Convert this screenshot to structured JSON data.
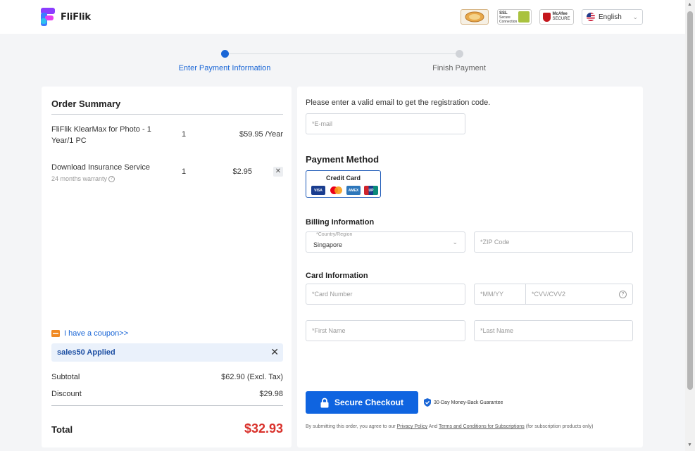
{
  "header": {
    "brand": "FliFlik",
    "badges": [
      "Norton",
      "SSL Secure Connection",
      "McAfee SECURE"
    ],
    "badge_mcafee_top": "McAfee",
    "badge_mcafee_bottom": "SECURE",
    "badge_ssl_line1": "SSL",
    "badge_ssl_line2": "Secure",
    "badge_ssl_line3": "Connection",
    "language": "English"
  },
  "steps": {
    "step1": "Enter Payment Information",
    "step2": "Finish Payment",
    "active_color": "#1a66d6",
    "inactive_color": "#d0d3d8"
  },
  "order": {
    "title": "Order Summary",
    "items": [
      {
        "name": "FliFlik KlearMax for Photo - 1 Year/1 PC",
        "qty": "1",
        "price": "$59.95 /Year"
      },
      {
        "name": "Download Insurance Service",
        "sub": "24 months warranty",
        "qty": "1",
        "price": "$2.95"
      }
    ],
    "coupon_link": "I have a coupon>>",
    "coupon_applied": "sales50 Applied",
    "subtotal_label": "Subtotal",
    "subtotal_value": "$62.90 (Excl. Tax)",
    "discount_label": "Discount",
    "discount_value": "$29.98",
    "total_label": "Total",
    "total_value": "$32.93"
  },
  "payment": {
    "email_prompt": "Please enter a valid email to get the registration code.",
    "email_placeholder": "*E-mail",
    "method_title": "Payment Method",
    "credit_card_label": "Credit Card",
    "card_brands": [
      "VISA",
      "Mastercard",
      "AMEX",
      "UnionPay"
    ],
    "billing_title": "Billing Information",
    "country_label": "*Country/Region",
    "country_value": "Singapore",
    "zip_placeholder": "*ZIP Code",
    "card_title": "Card Information",
    "card_number_placeholder": "*Card Number",
    "expiry_placeholder": "*MM/YY",
    "cvv_placeholder": "*CVV/CVV2",
    "first_name_placeholder": "*First Name",
    "last_name_placeholder": "*Last Name",
    "checkout_label": "Secure Checkout",
    "guarantee": "30-Day Money-Back Guarantee",
    "terms_prefix": "By submitting this order, you agree to our",
    "terms_privacy": "Privacy Policy",
    "terms_and": "And",
    "terms_conditions": "Terms and Conditions for Subscriptions",
    "terms_suffix": "(for subscription products only)",
    "accent_color": "#0f64e0",
    "total_color": "#d9312b"
  }
}
